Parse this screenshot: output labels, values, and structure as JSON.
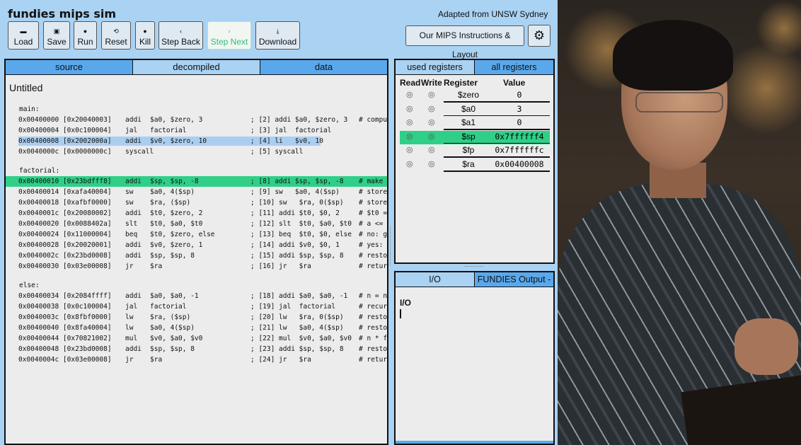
{
  "app": {
    "title": "fundies mips sim",
    "adapted": "Adapted from UNSW Sydney",
    "toolbar": [
      {
        "id": "load",
        "label": "Load",
        "icon": "folder-icon",
        "glyph": "▬"
      },
      {
        "id": "save",
        "label": "Save",
        "icon": "save-icon",
        "glyph": "▣"
      },
      {
        "id": "run",
        "label": "Run",
        "icon": "play-icon",
        "glyph": "●"
      },
      {
        "id": "reset",
        "label": "Reset",
        "icon": "reset-icon",
        "glyph": "⟲"
      },
      {
        "id": "kill",
        "label": "Kill",
        "icon": "kill-icon",
        "glyph": "●"
      },
      {
        "id": "step_back",
        "label": "Step Back",
        "icon": "chevron-left-icon",
        "glyph": "‹"
      },
      {
        "id": "step_next",
        "label": "Step Next",
        "icon": "chevron-right-icon",
        "glyph": "›"
      },
      {
        "id": "download",
        "label": "Download",
        "icon": "download-icon",
        "glyph": "⤓"
      }
    ],
    "instructions_button": "Our MIPS Instructions & Layout",
    "settings_icon": "gear-icon"
  },
  "source_panel": {
    "tabs": [
      "source",
      "decompiled",
      "data"
    ],
    "active_tab": "decompiled",
    "file_name": "Untitled",
    "lines": [
      {
        "type": "label",
        "text": "main:"
      },
      {
        "addr": "0x00400000 [0x20040003]",
        "mn": "addi",
        "ops": "$a0, $zero, 3",
        "dec": "; [2] addi $a0, $zero, 3",
        "cm": "# comput"
      },
      {
        "addr": "0x00400004 [0x0c100004]",
        "mn": "jal",
        "ops": "factorial",
        "dec": "; [3] jal  factorial",
        "cm": ""
      },
      {
        "addr": "0x00400008 [0x2002000a]",
        "mn": "addi",
        "ops": "$v0, $zero, 10",
        "dec": "; [4] li   $v0, 10",
        "cm": "",
        "state": "selected"
      },
      {
        "addr": "0x0040000c [0x0000000c]",
        "mn": "syscall",
        "ops": "",
        "dec": "; [5] syscall",
        "cm": ""
      },
      {
        "type": "gap"
      },
      {
        "type": "label",
        "text": "factorial:"
      },
      {
        "addr": "0x00400010 [0x23bdfff8]",
        "mn": "addi",
        "ops": "$sp, $sp, -8",
        "dec": "; [8] addi $sp, $sp, -8",
        "cm": "# make roo",
        "state": "current"
      },
      {
        "addr": "0x00400014 [0xafa40004]",
        "mn": "sw",
        "ops": "$a0, 4($sp)",
        "dec": "; [9] sw   $a0, 4($sp)",
        "cm": "# store"
      },
      {
        "addr": "0x00400018 [0xafbf0000]",
        "mn": "sw",
        "ops": "$ra, ($sp)",
        "dec": "; [10] sw   $ra, 0($sp)",
        "cm": "# store"
      },
      {
        "addr": "0x0040001c [0x20080002]",
        "mn": "addi",
        "ops": "$t0, $zero, 2",
        "dec": "; [11] addi $t0, $0, 2",
        "cm": "# $t0 ="
      },
      {
        "addr": "0x00400020 [0x0088402a]",
        "mn": "slt",
        "ops": "$t0, $a0, $t0",
        "dec": "; [12] slt  $t0, $a0, $t0",
        "cm": "# a <= 1"
      },
      {
        "addr": "0x00400024 [0x11000004]",
        "mn": "beq",
        "ops": "$t0, $zero, else",
        "dec": "; [13] beq  $t0, $0, else",
        "cm": "# no: go"
      },
      {
        "addr": "0x00400028 [0x20020001]",
        "mn": "addi",
        "ops": "$v0, $zero, 1",
        "dec": "; [14] addi $v0, $0, 1",
        "cm": "# yes: r"
      },
      {
        "addr": "0x0040002c [0x23bd0008]",
        "mn": "addi",
        "ops": "$sp, $sp, 8",
        "dec": "; [15] addi $sp, $sp, 8",
        "cm": "# restor"
      },
      {
        "addr": "0x00400030 [0x03e00008]",
        "mn": "jr",
        "ops": "$ra",
        "dec": "; [16] jr   $ra",
        "cm": "# return"
      },
      {
        "type": "gap"
      },
      {
        "type": "label",
        "text": "else:"
      },
      {
        "addr": "0x00400034 [0x2084ffff]",
        "mn": "addi",
        "ops": "$a0, $a0, -1",
        "dec": "; [18] addi $a0, $a0, -1",
        "cm": "# n = n"
      },
      {
        "addr": "0x00400038 [0x0c100004]",
        "mn": "jal",
        "ops": "factorial",
        "dec": "; [19] jal  factorial",
        "cm": "# recurs"
      },
      {
        "addr": "0x0040003c [0x8fbf0000]",
        "mn": "lw",
        "ops": "$ra, ($sp)",
        "dec": "; [20] lw   $ra, 0($sp)",
        "cm": "# restor"
      },
      {
        "addr": "0x00400040 [0x8fa40004]",
        "mn": "lw",
        "ops": "$a0, 4($sp)",
        "dec": "; [21] lw   $a0, 4($sp)",
        "cm": "# restor"
      },
      {
        "addr": "0x00400044 [0x70821002]",
        "mn": "mul",
        "ops": "$v0, $a0, $v0",
        "dec": "; [22] mul  $v0, $a0, $v0",
        "cm": "# n * fa"
      },
      {
        "addr": "0x00400048 [0x23bd0008]",
        "mn": "addi",
        "ops": "$sp, $sp, 8",
        "dec": "; [23] addi $sp, $sp, 8",
        "cm": "# restor"
      },
      {
        "addr": "0x0040004c [0x03e00008]",
        "mn": "jr",
        "ops": "$ra",
        "dec": "; [24] jr   $ra",
        "cm": "# return"
      }
    ]
  },
  "registers": {
    "tabs": [
      "used registers",
      "all registers"
    ],
    "active_tab": "used registers",
    "headers": {
      "read": "Read",
      "write": "Write",
      "register": "Register",
      "value": "Value"
    },
    "radio_glyph": "◎",
    "rows": [
      {
        "name": "$zero",
        "value": "0"
      },
      {
        "name": "$a0",
        "value": "3"
      },
      {
        "name": "$a1",
        "value": "0"
      },
      {
        "name": "$sp",
        "value": "0x7ffffff4",
        "highlight": true
      },
      {
        "name": "$fp",
        "value": "0x7ffffffc"
      },
      {
        "name": "$ra",
        "value": "0x00400008"
      }
    ]
  },
  "io": {
    "tabs": [
      "I/O",
      "FUNDIES Output -"
    ],
    "active_tab": "I/O",
    "title": "I/O"
  },
  "colors": {
    "background": "#a9d2f3",
    "tab_blue": "#5aa8ec",
    "current_line": "#2fcf87",
    "selected_line": "#a9cff0",
    "step_next_text": "#2fbf79"
  }
}
